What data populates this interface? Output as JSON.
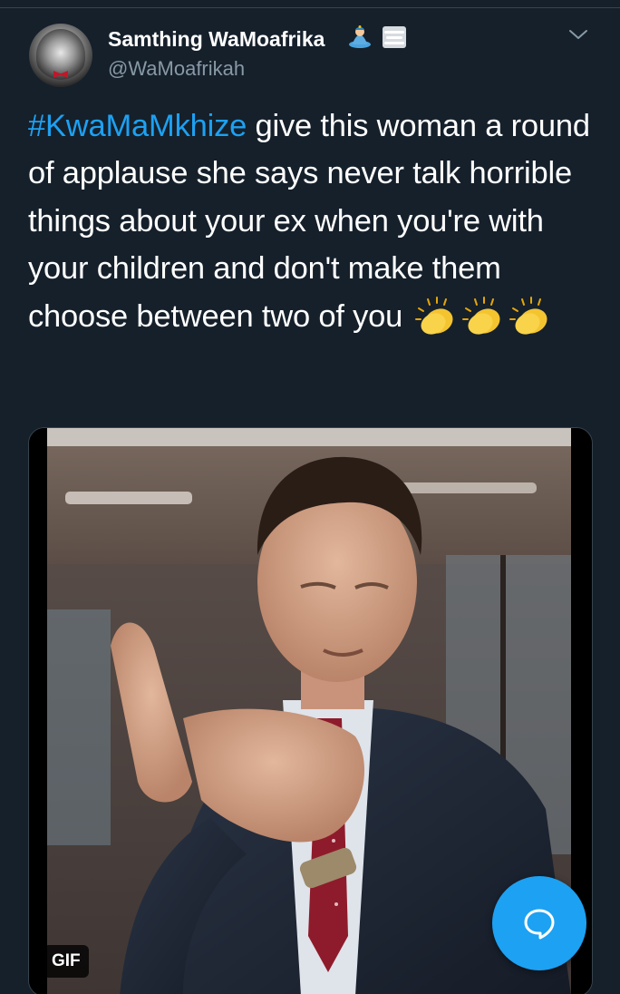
{
  "tweet": {
    "display_name": "Samthing WaMoafrika",
    "handle": "@WaMoafrikah",
    "name_emojis": [
      "genie-emoji",
      "fog-emoji"
    ],
    "text": {
      "hashtag": "#KwaMaMkhize",
      "body": "give this woman a round of applause she says never talk horrible things about your ex when you're with your children and don't make them choose between two of you",
      "trailing_emojis": [
        "clapping-hands-emoji",
        "clapping-hands-emoji",
        "clapping-hands-emoji"
      ]
    },
    "media": {
      "type": "gif",
      "badge_label": "GIF",
      "subject": "man-in-suit-clapping"
    }
  },
  "icons": {
    "menu": "chevron-down-icon",
    "compose": "new-reply-icon"
  },
  "colors": {
    "background": "#15202b",
    "primary_text": "#ffffff",
    "secondary_text": "#8899a6",
    "accent": "#1da1f2"
  }
}
